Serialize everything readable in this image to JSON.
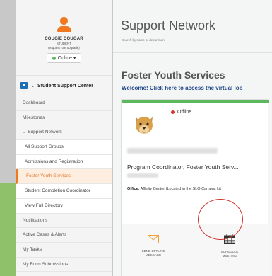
{
  "profile": {
    "name": "COUGIE COUGAR",
    "role": "STUDENT",
    "request_note": "(request role upgrade)",
    "status_label": "Online",
    "status_caret": "▾"
  },
  "sidebar": {
    "section_label": "Student Support Center",
    "section_chevron": "⌄",
    "items": [
      {
        "label": "Dashboard",
        "kind": "top"
      },
      {
        "label": "Milestones",
        "kind": "top"
      },
      {
        "label": "Support Network",
        "kind": "top",
        "chevron": "⌄"
      },
      {
        "label": "All Support Groups",
        "kind": "sub"
      },
      {
        "label": "Admissions and Registration",
        "kind": "sub"
      },
      {
        "label": "Foster Youth Services",
        "kind": "sub",
        "active": true
      },
      {
        "label": "Student Completion Coordinator",
        "kind": "sub"
      },
      {
        "label": "View Full Directory",
        "kind": "sub"
      },
      {
        "label": "Notifications",
        "kind": "top"
      },
      {
        "label": "Active Cases & Alerts",
        "kind": "top"
      },
      {
        "label": "My Tasks",
        "kind": "top"
      },
      {
        "label": "My Form Submissions",
        "kind": "top"
      }
    ]
  },
  "main": {
    "title": "Support Network",
    "subtitle": "Search by name or department",
    "section_title": "Foster Youth Services",
    "welcome_text": "Welcome! Click here to access the virtual lob"
  },
  "card": {
    "status": "Offline",
    "job_title": "Program Coordinator, Foster Youth Serv...",
    "office_label": "Office:",
    "office_value": "Affinity Center (Located in the SLO Campus Lit",
    "actions": [
      {
        "line1": "SEND OFFLINE",
        "line2": "MESSAGE",
        "icon": "envelope-icon"
      },
      {
        "line1": "SCHEDULE",
        "line2": "MEETING",
        "icon": "calendar-icon"
      }
    ]
  },
  "colors": {
    "accent_orange": "#f0781e",
    "online_green": "#5cb85c",
    "offline_red": "#d9342b",
    "link_blue": "#244a8a",
    "annotation_red": "#d0322a"
  }
}
